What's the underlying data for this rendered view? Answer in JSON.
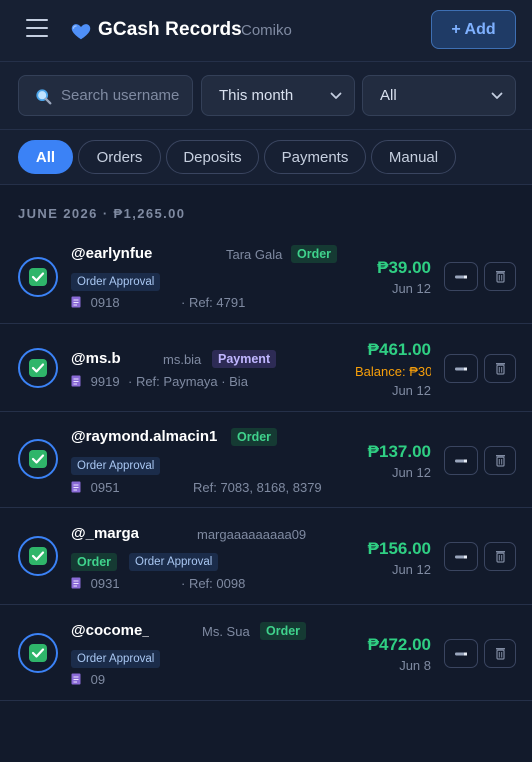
{
  "header": {
    "title": "GCash Records",
    "subtitle": "Comiko",
    "add_label": "+ Add",
    "menu_icon": "hamburger-menu-icon",
    "logo_icon": "blue-heart-icon"
  },
  "filters": {
    "search_placeholder": "Search username",
    "search_icon": "magnifier-icon",
    "period_value": "This month",
    "type_value": "All"
  },
  "tabs": [
    "All",
    "Orders",
    "Deposits",
    "Payments",
    "Manual"
  ],
  "active_tab": "All",
  "section": {
    "title": "JUNE 2026 · ₱1,265.00"
  },
  "colors": {
    "accent": "#3b82f6",
    "amount": "#2fcf83",
    "balance": "#f59e0b",
    "background": "#121a2b"
  },
  "records": [
    {
      "username": "@earlynfue",
      "name": "Tara Gala",
      "type_badge": "Order",
      "approval_badge": "Order Approval",
      "phone": "0918",
      "ref": "· Ref: 4791",
      "amount": "₱39.00",
      "date": "Jun 12"
    },
    {
      "username": "@ms.b",
      "name": "ms.bia",
      "type_badge": "Payment",
      "phone": "9919",
      "ref": "· Ref: Paymaya · Bia",
      "amount": "₱461.00",
      "balance": "Balance: ₱30",
      "date": "Jun 12"
    },
    {
      "username": "@raymond.almacin1",
      "type_badge": "Order",
      "approval_badge": "Order Approval",
      "phone": "0951",
      "ref": "Ref: 7083, 8168, 8379",
      "amount": "₱137.00",
      "date": "Jun 12"
    },
    {
      "username": "@_marga",
      "name": "margaaaaaaaaa09",
      "type_badge": "Order",
      "approval_badge": "Order Approval",
      "phone": "0931",
      "ref": "· Ref: 0098",
      "amount": "₱156.00",
      "date": "Jun 12"
    },
    {
      "username": "@cocome_",
      "name": "Ms. Sua",
      "type_badge": "Order",
      "approval_badge": "Order Approval",
      "phone": "09",
      "amount": "₱472.00",
      "date": "Jun 8"
    }
  ]
}
